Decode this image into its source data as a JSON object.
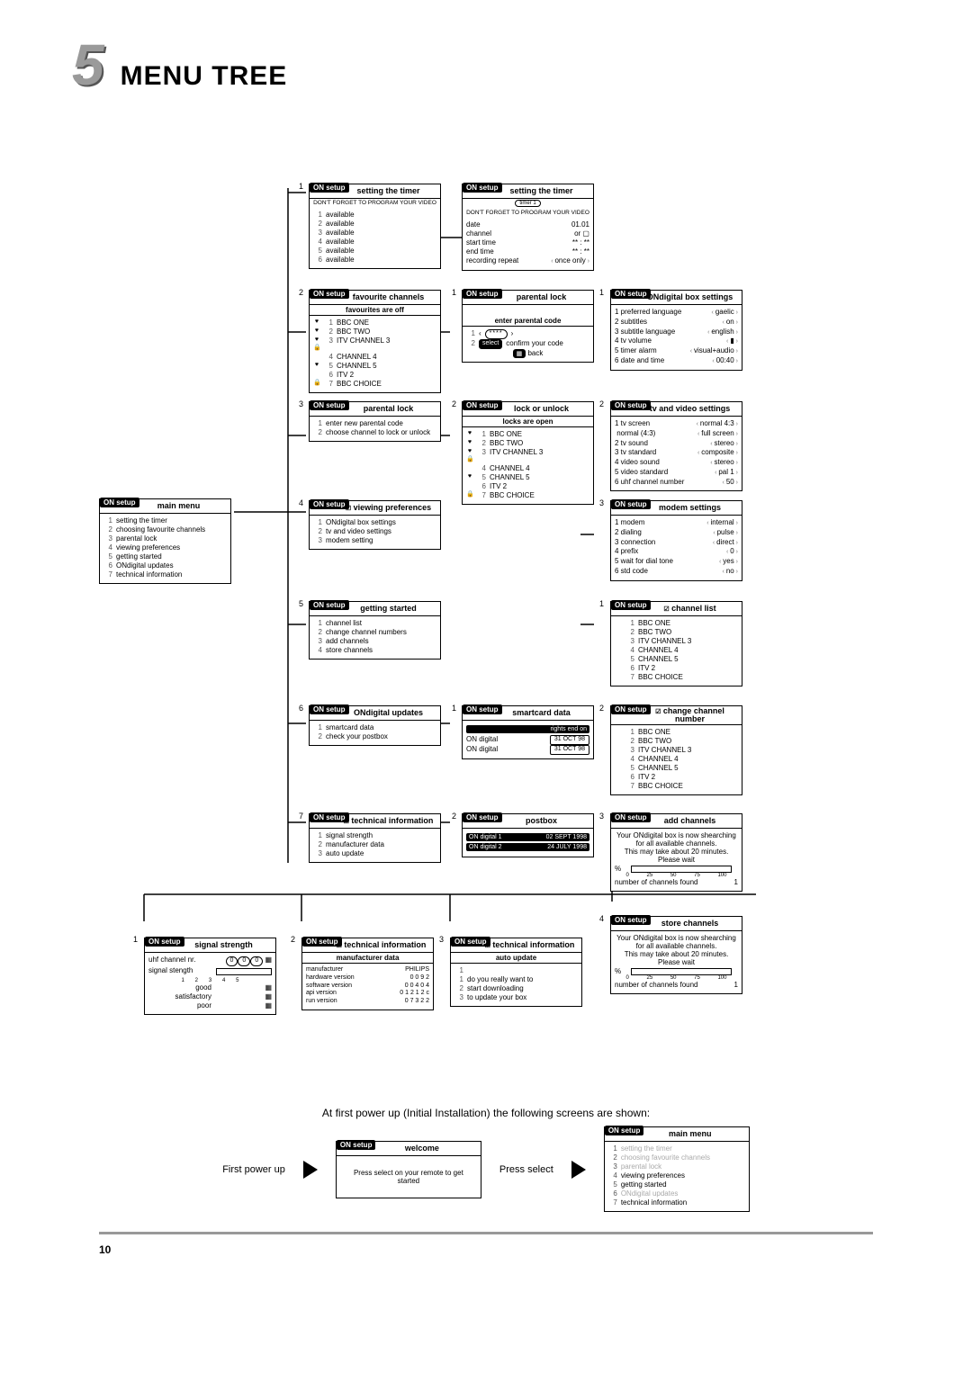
{
  "page_number": "10",
  "section_number": "5",
  "section_title": "MENU TREE",
  "setup_tag": "ON setup",
  "channels7": [
    "BBC ONE",
    "BBC TWO",
    "ITV CHANNEL 3",
    "CHANNEL 4",
    "CHANNEL 5",
    "ITV 2",
    "BBC CHOICE"
  ],
  "main_menu": {
    "title": "main menu",
    "items": [
      "setting the timer",
      "choosing favourite channels",
      "parental lock",
      "viewing preferences",
      "getting started",
      "ONdigital updates",
      "technical information"
    ]
  },
  "r1_timer_a": {
    "title": "setting the timer",
    "note": "DON'T FORGET TO PROGRAM YOUR VIDEO",
    "items": [
      "available",
      "available",
      "available",
      "available",
      "available",
      "available"
    ]
  },
  "r1_timer_b": {
    "title": "setting the timer",
    "sub": "timer 1",
    "note": "DON'T FORGET TO PROGRAM YOUR VIDEO",
    "rows": [
      {
        "k": "date",
        "v": "01.01"
      },
      {
        "k": "channel",
        "v": "or ▢"
      },
      {
        "k": "start time",
        "v": "** : **"
      },
      {
        "k": "end time",
        "v": "** : **"
      },
      {
        "k": "recording repeat",
        "v": "once only",
        "arrows": true
      }
    ]
  },
  "r2_fav": {
    "title": "favourite channels",
    "sub": "favourites are off"
  },
  "r2_plock": {
    "title": "parental lock",
    "enter": "enter parental code",
    "stars": "****",
    "confirm": "confirm your code",
    "select": "select",
    "back": "back"
  },
  "r2_box": {
    "title": "ONdigital box settings",
    "rows": [
      {
        "n": "1",
        "k": "preferred language",
        "v": "gaelic"
      },
      {
        "n": "2",
        "k": "subtitles",
        "v": "on"
      },
      {
        "n": "3",
        "k": "subtitle language",
        "v": "english"
      },
      {
        "n": "4",
        "k": "tv volume",
        "v": "▮"
      },
      {
        "n": "5",
        "k": "timer alarm",
        "v": "visual+audio"
      },
      {
        "n": "6",
        "k": "date and time",
        "v": "00:40"
      }
    ]
  },
  "r3_plock": {
    "title": "parental lock",
    "items": [
      "enter new parental code",
      "choose channel to lock or unlock"
    ]
  },
  "r3_locks": {
    "title": "lock or unlock",
    "sub": "locks are open"
  },
  "r3_tv": {
    "title": "tv and video settings",
    "rows": [
      {
        "n": "1",
        "k": "tv screen",
        "v": "normal 4:3"
      },
      {
        "n": "",
        "k": "normal (4:3)",
        "v": "full screen"
      },
      {
        "n": "2",
        "k": "tv sound",
        "v": "stereo"
      },
      {
        "n": "3",
        "k": "tv standard",
        "v": "composite"
      },
      {
        "n": "4",
        "k": "video sound",
        "v": "stereo"
      },
      {
        "n": "5",
        "k": "video standard",
        "v": "pal 1"
      },
      {
        "n": "6",
        "k": "uhf channel number",
        "v": "50"
      }
    ]
  },
  "r4_view": {
    "title": "viewing preferences",
    "items": [
      "ONdigital box settings",
      "tv and video settings",
      "modem setting"
    ]
  },
  "r4_modem": {
    "title": "modem settings",
    "rows": [
      {
        "k": "modem",
        "n": "1",
        "v": "internal"
      },
      {
        "k": "dialing",
        "n": "2",
        "v": "pulse"
      },
      {
        "k": "connection",
        "n": "3",
        "v": "direct"
      },
      {
        "k": "prefix",
        "n": "4",
        "v": "0"
      },
      {
        "k": "wait for dial tone",
        "n": "5",
        "v": "yes"
      },
      {
        "k": "std code",
        "n": "6",
        "v": "no"
      }
    ]
  },
  "r5_start": {
    "title": "getting started",
    "items": [
      "channel list",
      "change channel numbers",
      "add channels",
      "store channels"
    ]
  },
  "r5_chlist": {
    "title": "channel list"
  },
  "r6_upd": {
    "title": "ONdigital updates",
    "items": [
      "smartcard data",
      "check your postbox"
    ]
  },
  "r6_smart": {
    "title": "smartcard data",
    "rights": "rights end on",
    "lines": [
      {
        "a": "ON digital",
        "b": "31 OCT 98"
      },
      {
        "a": "ON digital",
        "b": "31 OCT 98"
      }
    ]
  },
  "r6_change": {
    "title": "change channel\nnumber"
  },
  "r7_tech": {
    "title": "technical information",
    "items": [
      "signal strength",
      "manufacturer data",
      "auto update"
    ]
  },
  "r7_postbox": {
    "title": "postbox",
    "lines": [
      {
        "a": "ON digital 1",
        "b": "02 SEPT 1998"
      },
      {
        "a": "ON digital 2",
        "b": "24 JULY 1998"
      }
    ]
  },
  "r7_add": {
    "title": "add channels",
    "msg1": "Your ONdigital box is now shearching",
    "msg2": "for all available channels.",
    "msg3": "This may take about 20 minutes.",
    "msg4": "Please wait",
    "pct": "%",
    "ticks": [
      "0",
      "25",
      "50",
      "75",
      "100"
    ],
    "found": "number of channels found",
    "found_n": "1"
  },
  "r7_store": {
    "title": "store channels"
  },
  "r8_sig": {
    "title": "signal strength",
    "r1k": "uhf channel nr.",
    "r2k": "signal stength",
    "ticks": [
      "1",
      "2",
      "3",
      "4",
      "5"
    ],
    "good": "good",
    "sat": "satisfactory",
    "poor": "poor"
  },
  "r8_mfr": {
    "title": "technical information",
    "sub": "manufacturer data",
    "rows": [
      {
        "k": "manufacturer",
        "v": "PHILIPS"
      },
      {
        "k": "hardware version",
        "v": "0 0 9 2"
      },
      {
        "k": "software version",
        "v": "0 0 4 0 4"
      },
      {
        "k": "api version",
        "v": "0 1 2 1 2 c"
      },
      {
        "k": "run version",
        "v": "0 7 3 2 2"
      }
    ]
  },
  "r8_auto": {
    "title": "technical information",
    "sub": "auto update",
    "items": [
      "",
      "do you really want to",
      "start downloading",
      "to update your box"
    ]
  },
  "initial_note": "At first power up (Initial Installation) the following screens are shown:",
  "welcome": {
    "title": "welcome",
    "body": "Press select on your remote to get started"
  },
  "first_power": "First power up",
  "press_select": "Press select",
  "final_menu_grey": [
    0,
    1,
    2,
    5
  ]
}
